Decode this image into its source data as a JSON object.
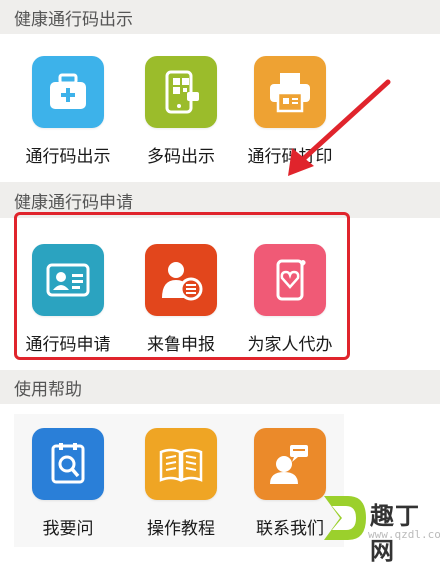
{
  "sections": {
    "show": {
      "title": "健康通行码出示",
      "items": [
        {
          "label": "通行码出示",
          "icon": "medical-kit-icon",
          "color": "#3db2ea"
        },
        {
          "label": "多码出示",
          "icon": "phone-qr-icon",
          "color": "#9bbc2b"
        },
        {
          "label": "通行码打印",
          "icon": "printer-icon",
          "color": "#eea233"
        }
      ]
    },
    "apply": {
      "title": "健康通行码申请",
      "items": [
        {
          "label": "通行码申请",
          "icon": "id-card-icon",
          "color": "#2ba3c0"
        },
        {
          "label": "来鲁申报",
          "icon": "person-report-icon",
          "color": "#e2461c"
        },
        {
          "label": "为家人代办",
          "icon": "phone-heart-icon",
          "color": "#f05a76"
        }
      ]
    },
    "help": {
      "title": "使用帮助",
      "items": [
        {
          "label": "我要问",
          "icon": "search-doc-icon",
          "color": "#2a7fd8"
        },
        {
          "label": "操作教程",
          "icon": "book-icon",
          "color": "#efa524"
        },
        {
          "label": "联系我们",
          "icon": "contact-chat-icon",
          "color": "#eb8a2a"
        }
      ]
    }
  },
  "annotation": {
    "color": "#e0242c"
  },
  "watermark": {
    "text": "趣丁网",
    "url": "www.qzdl.com"
  }
}
